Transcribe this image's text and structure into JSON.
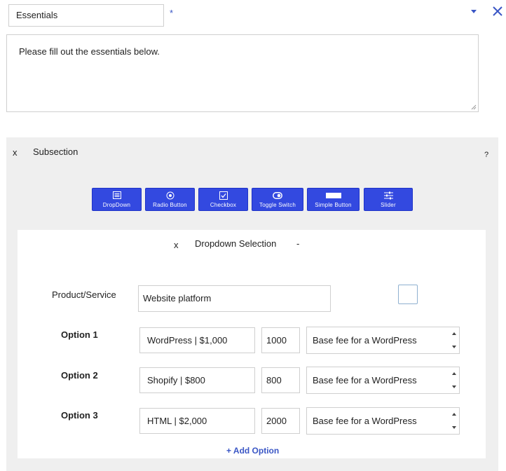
{
  "header": {
    "title_value": "Essentials",
    "required_mark": "*",
    "description": "Please fill out the essentials below."
  },
  "subsection": {
    "remove_label": "x",
    "title": "Subsection",
    "help_label": "?",
    "toolbar": [
      {
        "label": "DropDown",
        "icon": "list-icon"
      },
      {
        "label": "Radio Button",
        "icon": "radio-icon"
      },
      {
        "label": "Checkbox",
        "icon": "checkbox-icon"
      },
      {
        "label": "Toggle Switch",
        "icon": "toggle-icon"
      },
      {
        "label": "Simple Button",
        "icon": "button-icon"
      },
      {
        "label": "Slider",
        "icon": "sliders-icon"
      }
    ],
    "dropdown": {
      "remove_label": "x",
      "title": "Dropdown Selection",
      "collapse_label": "-",
      "product_label": "Product/Service",
      "product_value": "Website platform",
      "options": [
        {
          "label": "Option 1",
          "name": "WordPress | $1,000",
          "price": "1000",
          "description": "Base fee for a WordPress"
        },
        {
          "label": "Option 2",
          "name": "Shopify | $800",
          "price": "800",
          "description": "Base fee for a WordPress"
        },
        {
          "label": "Option 3",
          "name": "HTML | $2,000",
          "price": "2000",
          "description": "Base fee for a WordPress"
        }
      ],
      "add_option_label": "+ Add Option"
    }
  }
}
